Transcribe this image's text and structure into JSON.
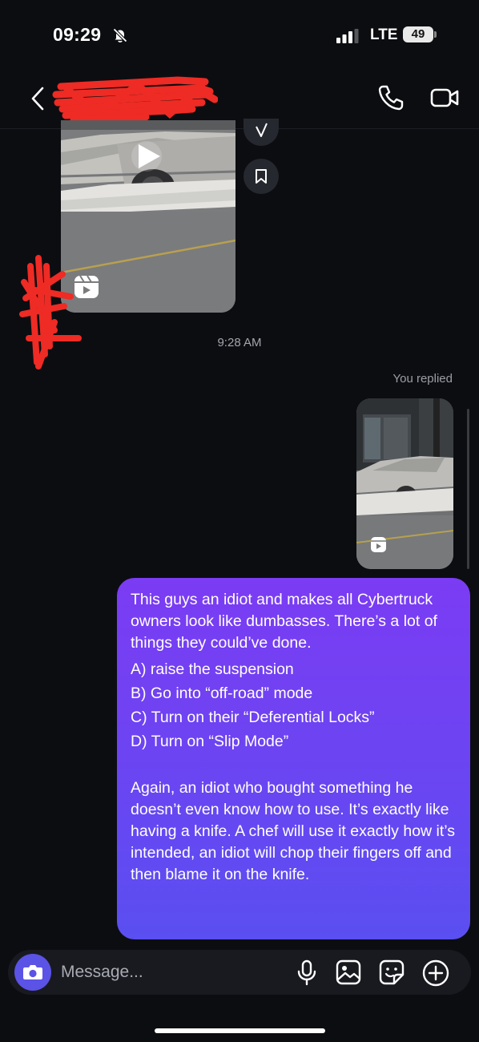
{
  "status_bar": {
    "time": "09:29",
    "network": "LTE",
    "battery": "49",
    "icons": [
      "bell-off-icon",
      "signal-icon"
    ]
  },
  "header": {
    "contact_name": "",
    "icons": [
      "back-icon",
      "call-icon",
      "video-icon"
    ]
  },
  "thread": {
    "received_reel": {
      "kind": "reel",
      "icons": [
        "play-icon",
        "reels-icon",
        "share-icon",
        "bookmark-icon"
      ]
    },
    "timestamp": "9:28 AM",
    "reply_label": "You replied",
    "sent_reel": {
      "kind": "reel",
      "icons": [
        "reels-icon"
      ]
    },
    "message": {
      "intro": "This guys an idiot and makes all Cybertruck owners look like dumbasses. There’s a lot of things they could’ve done.",
      "options": [
        "A) raise the suspension",
        "B) Go into “off-road” mode",
        "C) Turn on their “Deferential Locks”",
        "D) Turn on “Slip Mode”"
      ],
      "closing": "Again, an idiot who bought something he doesn’t even know how to use. It’s exactly like having a knife. A chef will use it exactly how it’s intended, an idiot will chop their fingers off and then blame it on the knife."
    }
  },
  "composer": {
    "placeholder": "Message...",
    "value": "",
    "icons": [
      "camera-icon",
      "mic-icon",
      "gallery-icon",
      "sticker-icon",
      "add-icon"
    ]
  },
  "colors": {
    "background": "#0c0d11",
    "bubble_top": "#7b3cf3",
    "bubble_bottom": "#5a4ff1",
    "camera_button": "#5b53e6",
    "redaction": "#e8322a"
  }
}
